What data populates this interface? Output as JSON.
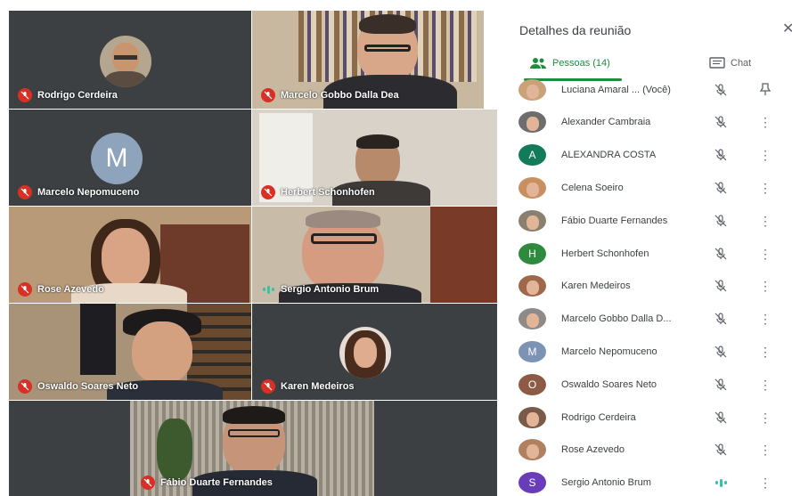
{
  "window": {
    "title": "Detalhes da reunião"
  },
  "tabs": {
    "people_label": "Pessoas (14)",
    "chat_label": "Chat"
  },
  "tiles": [
    {
      "name": "Rodrigo Cerdeira",
      "muted": true
    },
    {
      "name": "Marcelo Gobbo Dalla Dea",
      "muted": true
    },
    {
      "name": "Marcelo Nepomuceno",
      "muted": true,
      "initial": "M"
    },
    {
      "name": "Herbert Schonhofen",
      "muted": true
    },
    {
      "name": "Rose Azevedo",
      "muted": true
    },
    {
      "name": "Sergio Antonio Brum",
      "muted": false,
      "speaking": true
    },
    {
      "name": "Oswaldo Soares Neto",
      "muted": true
    },
    {
      "name": "Karen Medeiros",
      "muted": true
    },
    {
      "name": "Fábio Duarte Fernandes",
      "muted": true
    }
  ],
  "participants": [
    {
      "name": "Luciana Amaral ...  (Você)",
      "avatar": "photo",
      "color": "#c9a27a",
      "status": "muted",
      "action": "pin"
    },
    {
      "name": "Alexander Cambraia",
      "avatar": "photo",
      "color": "#6d6d6d",
      "status": "muted",
      "action": "more"
    },
    {
      "name": "ALEXANDRA COSTA",
      "avatar": "A",
      "color": "#137a5a",
      "status": "muted",
      "action": "more"
    },
    {
      "name": "Celena Soeiro",
      "avatar": "photo",
      "color": "#c89060",
      "status": "muted",
      "action": "more"
    },
    {
      "name": "Fábio Duarte Fernandes",
      "avatar": "photo",
      "color": "#8a8070",
      "status": "muted",
      "action": "more"
    },
    {
      "name": "Herbert Schonhofen",
      "avatar": "H",
      "color": "#2e8b3e",
      "status": "muted",
      "action": "more"
    },
    {
      "name": "Karen Medeiros",
      "avatar": "photo",
      "color": "#a0684a",
      "status": "muted",
      "action": "more"
    },
    {
      "name": "Marcelo Gobbo Dalla D...",
      "avatar": "photo",
      "color": "#8e8a88",
      "status": "muted",
      "action": "more"
    },
    {
      "name": "Marcelo Nepomuceno",
      "avatar": "M",
      "color": "#7c93b4",
      "status": "muted",
      "action": "more"
    },
    {
      "name": "Oswaldo Soares Neto",
      "avatar": "O",
      "color": "#8d5b45",
      "status": "muted",
      "action": "more"
    },
    {
      "name": "Rodrigo Cerdeira",
      "avatar": "photo",
      "color": "#7a5a48",
      "status": "muted",
      "action": "more"
    },
    {
      "name": "Rose Azevedo",
      "avatar": "photo",
      "color": "#b08060",
      "status": "muted",
      "action": "more"
    },
    {
      "name": "Sergio Antonio Brum",
      "avatar": "S",
      "color": "#6a3db8",
      "status": "speaking",
      "action": "more"
    }
  ],
  "colors": {
    "accent": "#1e8e3e",
    "muted_red": "#d93025",
    "speaking": "#34c3a4"
  },
  "icons": {
    "close": "close-icon",
    "people": "people-icon",
    "chat": "chat-icon",
    "mic_off": "mic-off-icon",
    "pin": "pin-icon",
    "more": "more-vert-icon"
  }
}
